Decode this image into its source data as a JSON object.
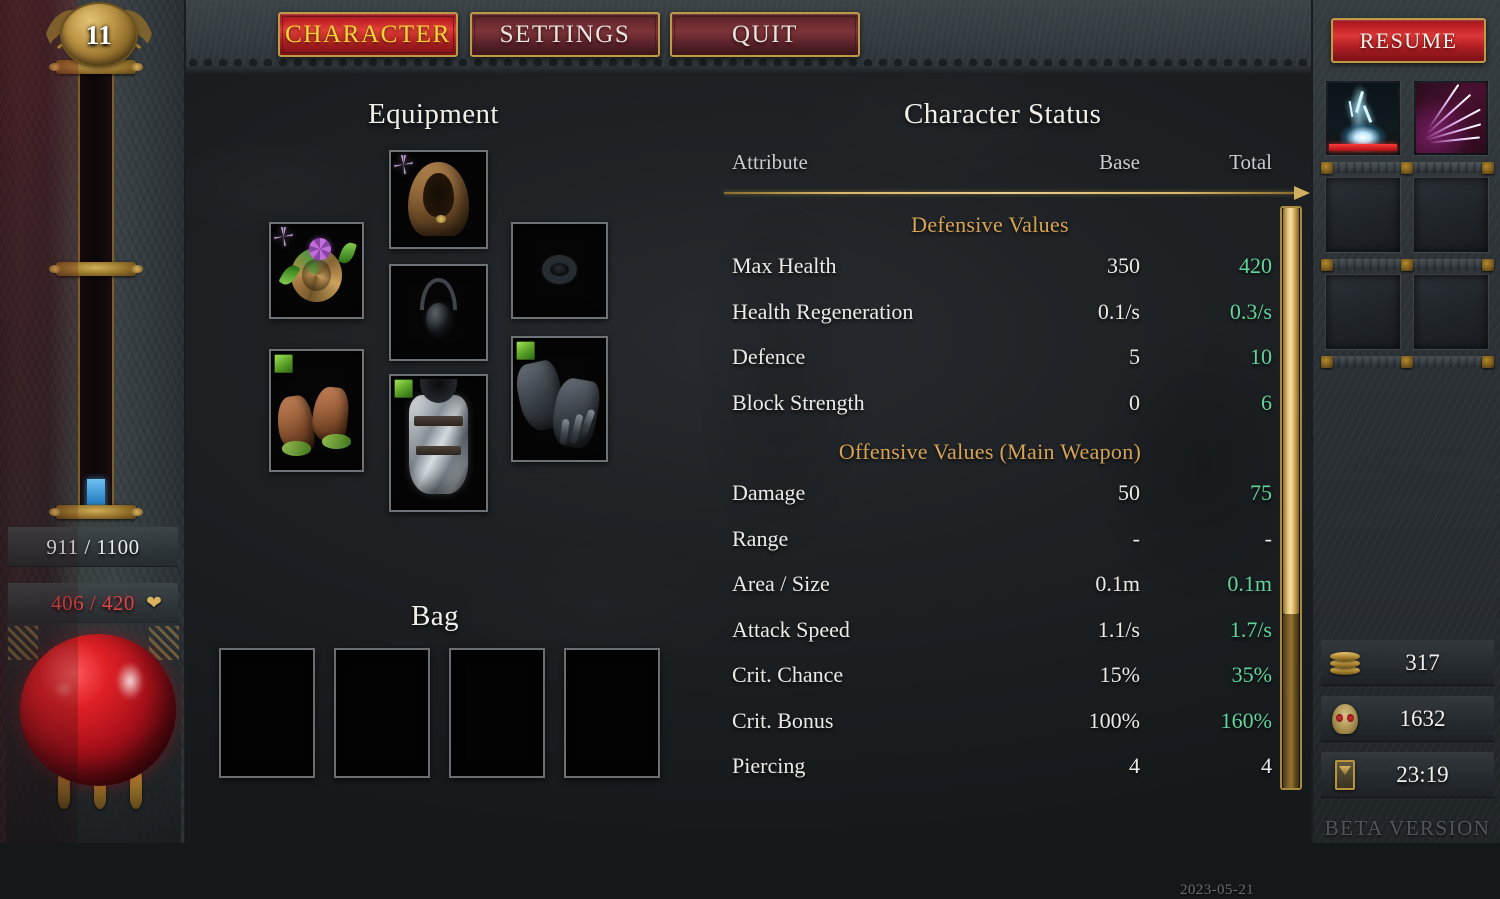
{
  "nav": {
    "buttons": [
      {
        "label": "CHARACTER",
        "active": true
      },
      {
        "label": "SETTINGS",
        "active": false
      },
      {
        "label": "QUIT",
        "active": false
      }
    ],
    "resume_label": "RESUME"
  },
  "hud": {
    "level": "11",
    "xp_text": "911 / 1100",
    "xp_current": 911,
    "xp_max": 1100,
    "health_text": "406 / 420",
    "health_current": 406,
    "health_max": 420
  },
  "resources": [
    {
      "icon": "coin-stack-icon",
      "value": "317"
    },
    {
      "icon": "skull-icon",
      "value": "1632"
    },
    {
      "icon": "hourglass-icon",
      "value": "23:19"
    }
  ],
  "skills": [
    {
      "name": "lightning-strike-skill",
      "has_cooldown": true
    },
    {
      "name": "piercing-spikes-skill",
      "has_cooldown": false
    }
  ],
  "sections": {
    "equipment_title": "Equipment",
    "bag_title": "Bag",
    "status_title": "Character Status"
  },
  "equipment_slots": [
    {
      "name": "helmet-slot",
      "item": "hooded-cloak",
      "badge": "star"
    },
    {
      "name": "ring-left-slot",
      "item": "flower-ring",
      "badge": "star"
    },
    {
      "name": "amulet-slot",
      "item": "dark-amulet",
      "badge": "none"
    },
    {
      "name": "ring-right-slot",
      "item": "dark-ring",
      "badge": "none"
    },
    {
      "name": "boots-slot",
      "item": "leather-boots",
      "badge": "green"
    },
    {
      "name": "chest-slot",
      "item": "plate-armor",
      "badge": "green"
    },
    {
      "name": "gloves-slot",
      "item": "gauntlets",
      "badge": "green"
    }
  ],
  "bag_slots": [
    {
      "name": "bag-slot-1",
      "empty": true
    },
    {
      "name": "bag-slot-2",
      "empty": true
    },
    {
      "name": "bag-slot-3",
      "empty": true
    },
    {
      "name": "bag-slot-4",
      "empty": true
    }
  ],
  "status_table": {
    "headers": {
      "attribute": "Attribute",
      "base": "Base",
      "total": "Total"
    },
    "groups": [
      {
        "title": "Defensive Values",
        "rows": [
          {
            "attribute": "Max Health",
            "base": "350",
            "total": "420",
            "highlight": true
          },
          {
            "attribute": "Health Regeneration",
            "base": "0.1/s",
            "total": "0.3/s",
            "highlight": true
          },
          {
            "attribute": "Defence",
            "base": "5",
            "total": "10",
            "highlight": true
          },
          {
            "attribute": "Block Strength",
            "base": "0",
            "total": "6",
            "highlight": true
          }
        ]
      },
      {
        "title": "Offensive Values (Main Weapon)",
        "rows": [
          {
            "attribute": "Damage",
            "base": "50",
            "total": "75",
            "highlight": true
          },
          {
            "attribute": "Range",
            "base": "-",
            "total": "-",
            "highlight": false
          },
          {
            "attribute": "Area / Size",
            "base": "0.1m",
            "total": "0.1m",
            "highlight": true
          },
          {
            "attribute": "Attack Speed",
            "base": "1.1/s",
            "total": "1.7/s",
            "highlight": true
          },
          {
            "attribute": "Crit. Chance",
            "base": "15%",
            "total": "35%",
            "highlight": true
          },
          {
            "attribute": "Crit. Bonus",
            "base": "100%",
            "total": "160%",
            "highlight": true
          },
          {
            "attribute": "Piercing",
            "base": "4",
            "total": "4",
            "highlight": false
          }
        ]
      }
    ],
    "scroll_percent": 70
  },
  "footer": {
    "date": "2023-05-21",
    "beta_label": "BETA VERSION"
  },
  "colors": {
    "accent_gold": "#d8b25c",
    "buff_green": "#63d49a",
    "health_red": "#d8474a",
    "active_button_text": "#f7d33c",
    "section_heading": "#d8a352"
  }
}
